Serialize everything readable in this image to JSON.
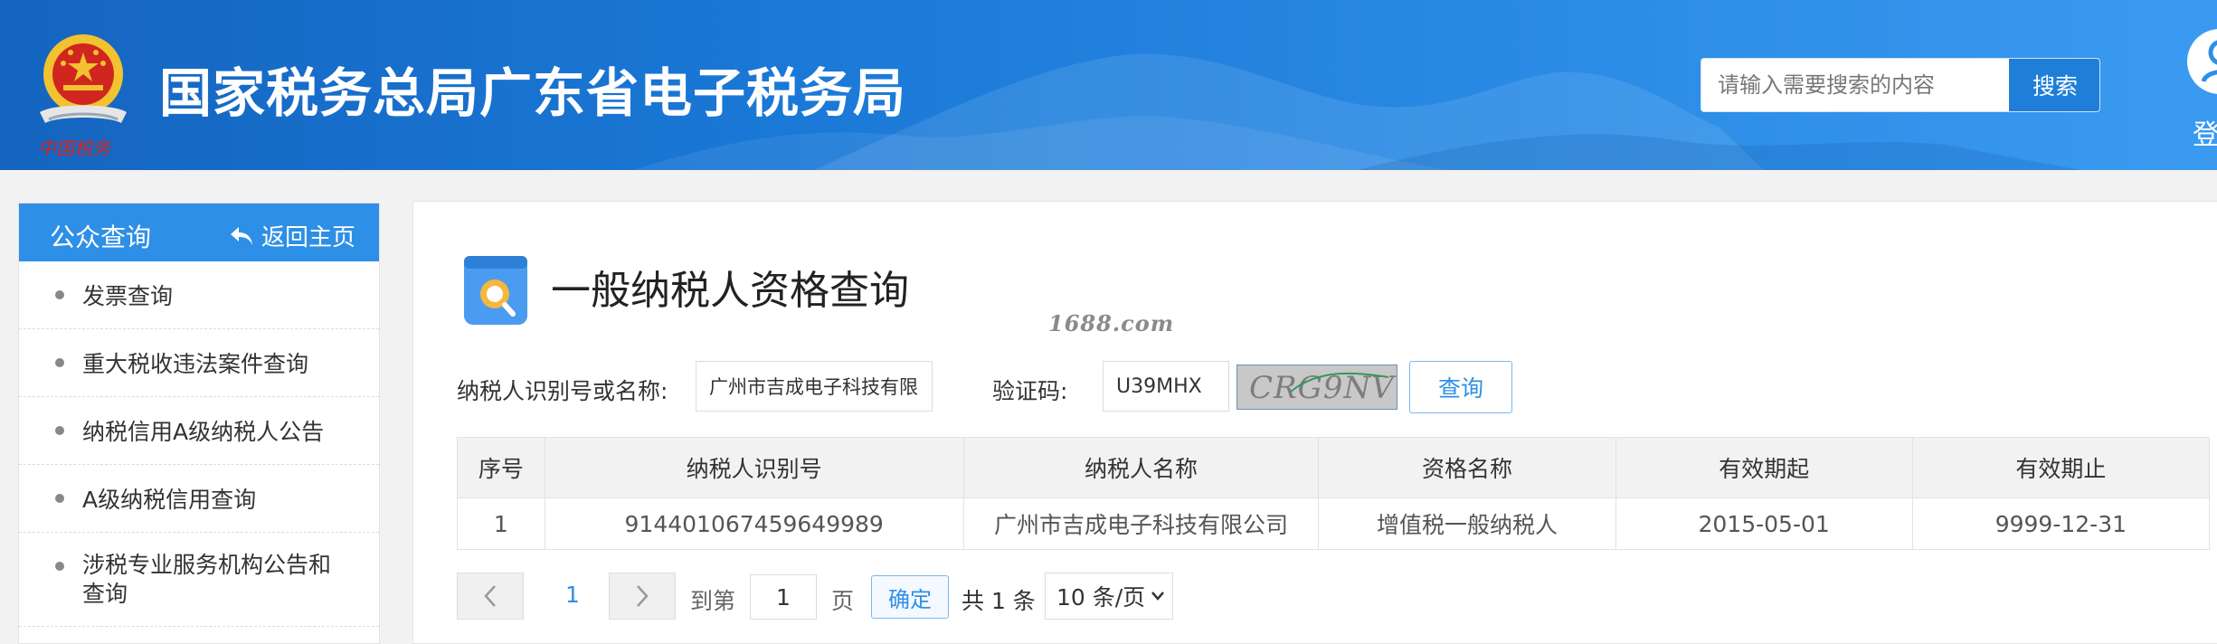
{
  "header": {
    "site_title": "国家税务总局广东省电子税务局",
    "emblem_caption": "中国税务",
    "search_placeholder": "请输入需要搜索的内容",
    "search_button": "搜索",
    "login_label": "登"
  },
  "sidebar": {
    "title": "公众查询",
    "back_label": "返回主页",
    "items": [
      {
        "label": "发票查询"
      },
      {
        "label": "重大税收违法案件查询"
      },
      {
        "label": "纳税信用A级纳税人公告"
      },
      {
        "label": "A级纳税信用查询"
      },
      {
        "label_line1": "涉税专业服务机构公告和",
        "label_line2": "查询"
      }
    ]
  },
  "main": {
    "page_title": "一般纳税人资格查询",
    "watermark": "1688.com",
    "form": {
      "taxpayer_label": "纳税人识别号或名称:",
      "taxpayer_value": "广州市吉成电子科技有限公司",
      "captcha_label": "验证码:",
      "captcha_value": "U39MHX",
      "captcha_image_text": "CRG9NV",
      "query_button": "查询"
    },
    "table": {
      "headers": [
        "序号",
        "纳税人识别号",
        "纳税人名称",
        "资格名称",
        "有效期起",
        "有效期止"
      ],
      "rows": [
        [
          "1",
          "914401067459649989",
          "广州市吉成电子科技有限公司",
          "增值税一般纳税人",
          "2015-05-01",
          "9999-12-31"
        ]
      ]
    },
    "pagination": {
      "current_page": "1",
      "goto_label": "到第",
      "goto_value": "1",
      "page_suffix": "页",
      "confirm": "确定",
      "total": "共 1 条",
      "page_size": "10 条/页"
    }
  },
  "colors": {
    "header_blue": "#1a78d6",
    "accent_blue": "#2e8fe6",
    "emblem_red": "#d0261f",
    "emblem_gold": "#f2c230"
  },
  "icons": [
    "national-emblem-icon",
    "user-avatar-icon",
    "back-arrow-icon",
    "search-document-icon",
    "chevron-left-icon",
    "chevron-right-icon",
    "chevron-down-icon"
  ]
}
